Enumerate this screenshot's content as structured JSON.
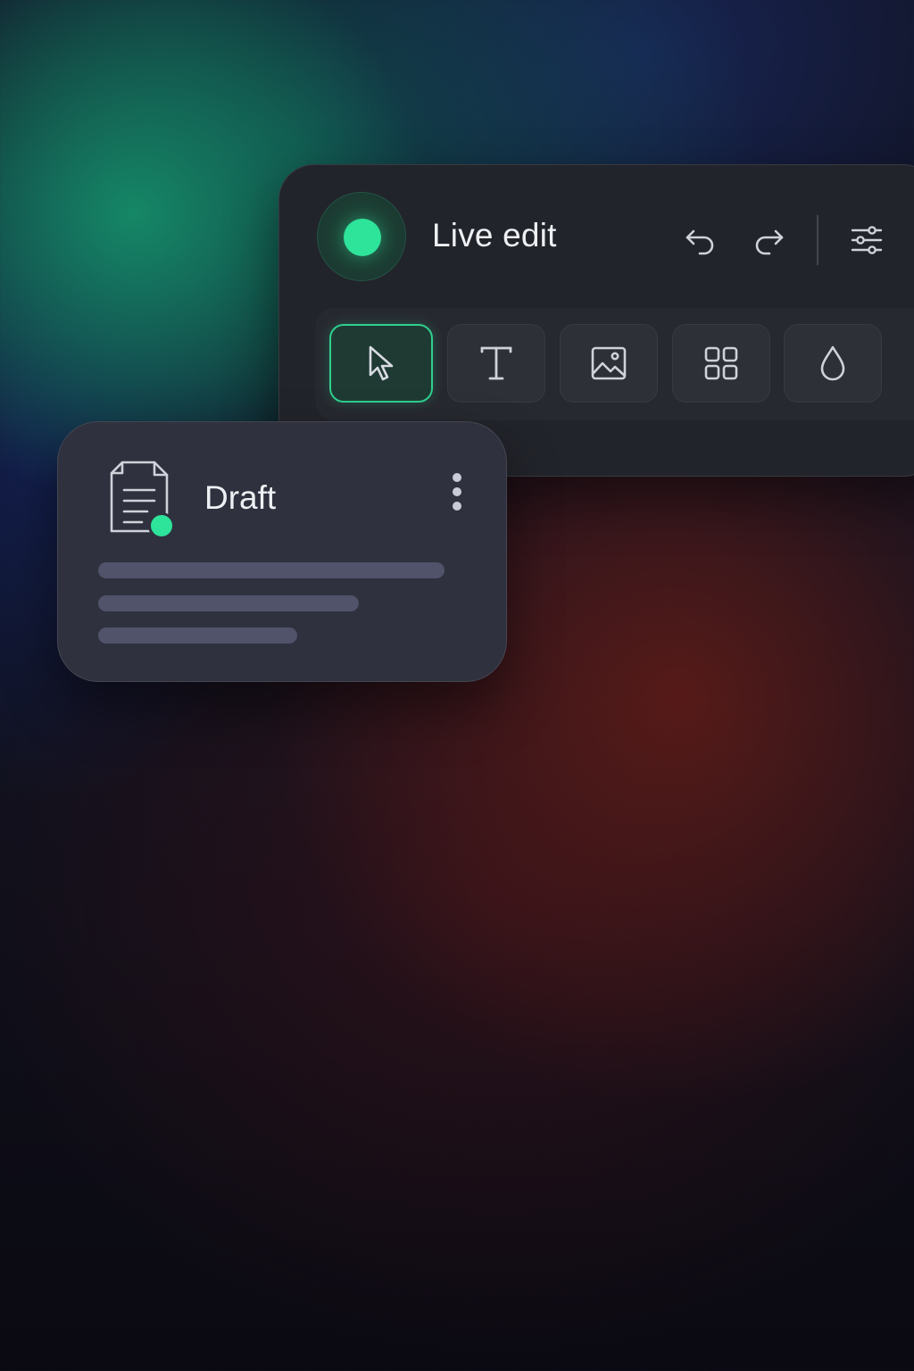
{
  "editor": {
    "title": "Live edit",
    "status": "live",
    "accent_color": "#2ee39a",
    "header_actions": [
      {
        "name": "undo",
        "icon": "undo-icon"
      },
      {
        "name": "redo",
        "icon": "redo-icon"
      },
      {
        "name": "settings",
        "icon": "sliders-icon"
      }
    ],
    "tools": [
      {
        "name": "select",
        "icon": "cursor-icon",
        "active": true
      },
      {
        "name": "text",
        "icon": "text-icon",
        "active": false
      },
      {
        "name": "image",
        "icon": "image-icon",
        "active": false
      },
      {
        "name": "components",
        "icon": "grid-icon",
        "active": false
      },
      {
        "name": "color",
        "icon": "droplet-icon",
        "active": false
      }
    ]
  },
  "draft_card": {
    "title": "Draft",
    "icon": "document-icon",
    "status_color": "#2ee39a",
    "menu_icon": "more-vertical-icon"
  }
}
